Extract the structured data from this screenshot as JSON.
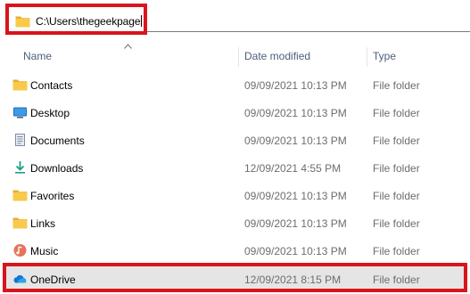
{
  "address_bar": {
    "path": "C:\\Users\\thegeekpage"
  },
  "columns": {
    "name": "Name",
    "date_modified": "Date modified",
    "type": "Type"
  },
  "items": [
    {
      "name": "Contacts",
      "date": "09/09/2021 10:13 PM",
      "type": "File folder",
      "icon": "folder-icon"
    },
    {
      "name": "Desktop",
      "date": "09/09/2021 10:13 PM",
      "type": "File folder",
      "icon": "desktop-icon"
    },
    {
      "name": "Documents",
      "date": "09/09/2021 10:13 PM",
      "type": "File folder",
      "icon": "documents-icon"
    },
    {
      "name": "Downloads",
      "date": "12/09/2021 4:55 PM",
      "type": "File folder",
      "icon": "download-icon"
    },
    {
      "name": "Favorites",
      "date": "09/09/2021 10:13 PM",
      "type": "File folder",
      "icon": "folder-icon"
    },
    {
      "name": "Links",
      "date": "09/09/2021 10:13 PM",
      "type": "File folder",
      "icon": "folder-icon"
    },
    {
      "name": "Music",
      "date": "09/09/2021 10:13 PM",
      "type": "File folder",
      "icon": "music-icon"
    },
    {
      "name": "OneDrive",
      "date": "12/09/2021 8:15 PM",
      "type": "File folder",
      "icon": "onedrive-icon",
      "highlighted": true
    }
  ],
  "colors": {
    "highlight_border": "#d9141b",
    "folder": "#f8c94a",
    "header_text": "#4c607a"
  }
}
